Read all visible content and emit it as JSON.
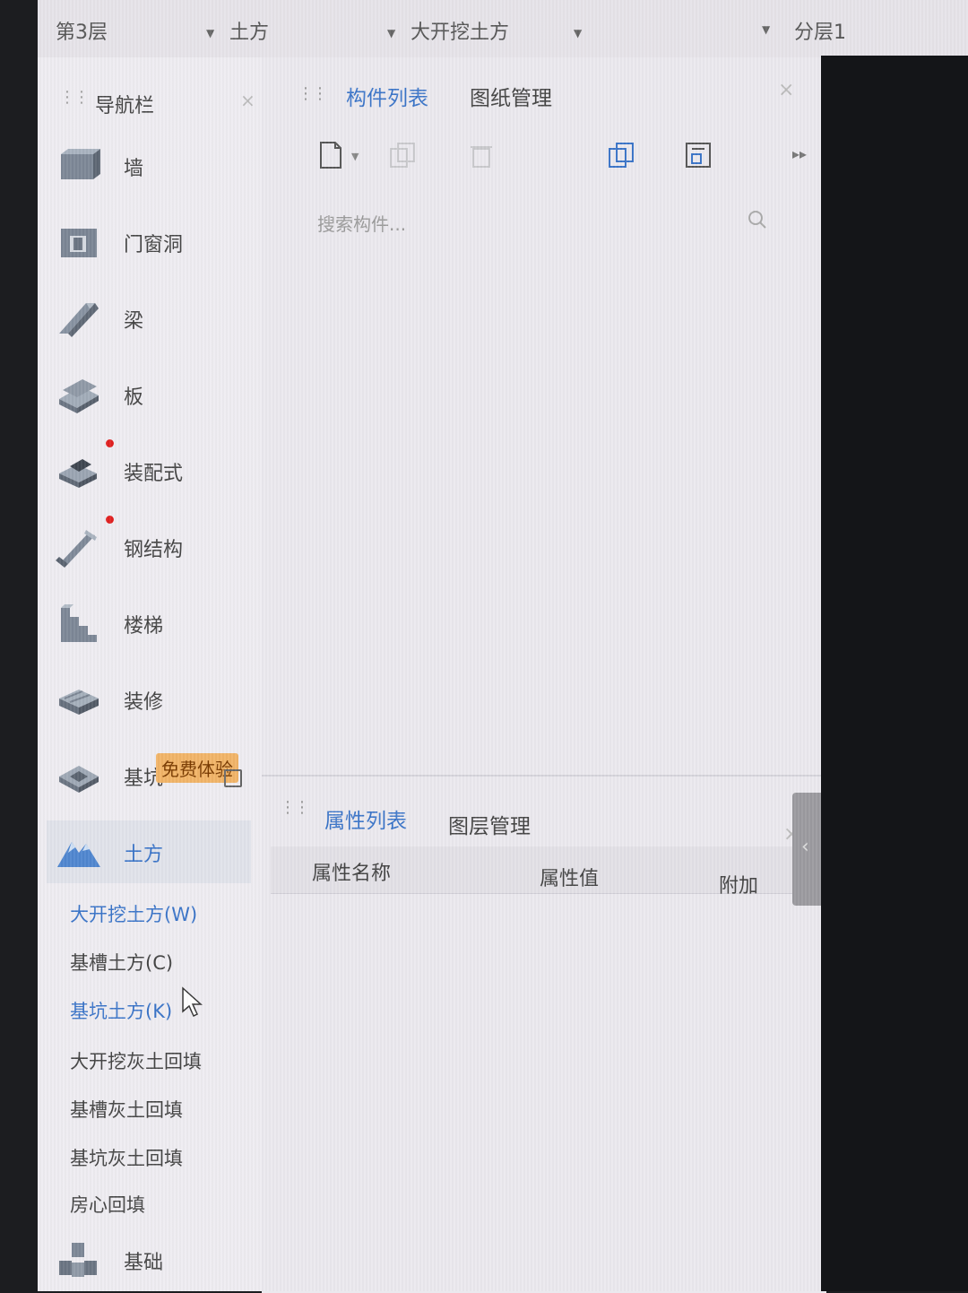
{
  "topbar": {
    "floor": "第3层",
    "category": "土方",
    "component_type": "大开挖土方",
    "layer": "分层1"
  },
  "nav": {
    "title": "导航栏",
    "items": [
      {
        "label": "墙",
        "icon": "wall-icon"
      },
      {
        "label": "门窗洞",
        "icon": "door-window-icon"
      },
      {
        "label": "梁",
        "icon": "beam-icon"
      },
      {
        "label": "板",
        "icon": "slab-icon"
      },
      {
        "label": "装配式",
        "icon": "prefab-icon",
        "dot": true
      },
      {
        "label": "钢结构",
        "icon": "steel-structure-icon",
        "dot": true
      },
      {
        "label": "楼梯",
        "icon": "stairs-icon"
      },
      {
        "label": "装修",
        "icon": "decoration-icon"
      },
      {
        "label": "基坑",
        "icon": "foundation-pit-icon",
        "badge": "免费体验"
      },
      {
        "label": "土方",
        "icon": "earthwork-icon",
        "active": true
      }
    ],
    "sub_items": [
      {
        "label": "大开挖土方(W)",
        "selected": true
      },
      {
        "label": "基槽土方(C)"
      },
      {
        "label": "基坑土方(K)",
        "selected": true
      },
      {
        "label": "大开挖灰土回填"
      },
      {
        "label": "基槽灰土回填"
      },
      {
        "label": "基坑灰土回填"
      },
      {
        "label": "房心回填"
      }
    ],
    "last_item": {
      "label": "基础",
      "icon": "foundation-icon"
    }
  },
  "component_panel": {
    "tabs": [
      "构件列表",
      "图纸管理"
    ],
    "search_placeholder": "搜索构件..."
  },
  "property_panel": {
    "tabs": [
      "属性列表",
      "图层管理"
    ],
    "columns": [
      "属性名称",
      "属性值",
      "附加"
    ]
  },
  "colors": {
    "accent": "#3a74c8",
    "badge": "#f1b467",
    "dot": "#e02020"
  }
}
